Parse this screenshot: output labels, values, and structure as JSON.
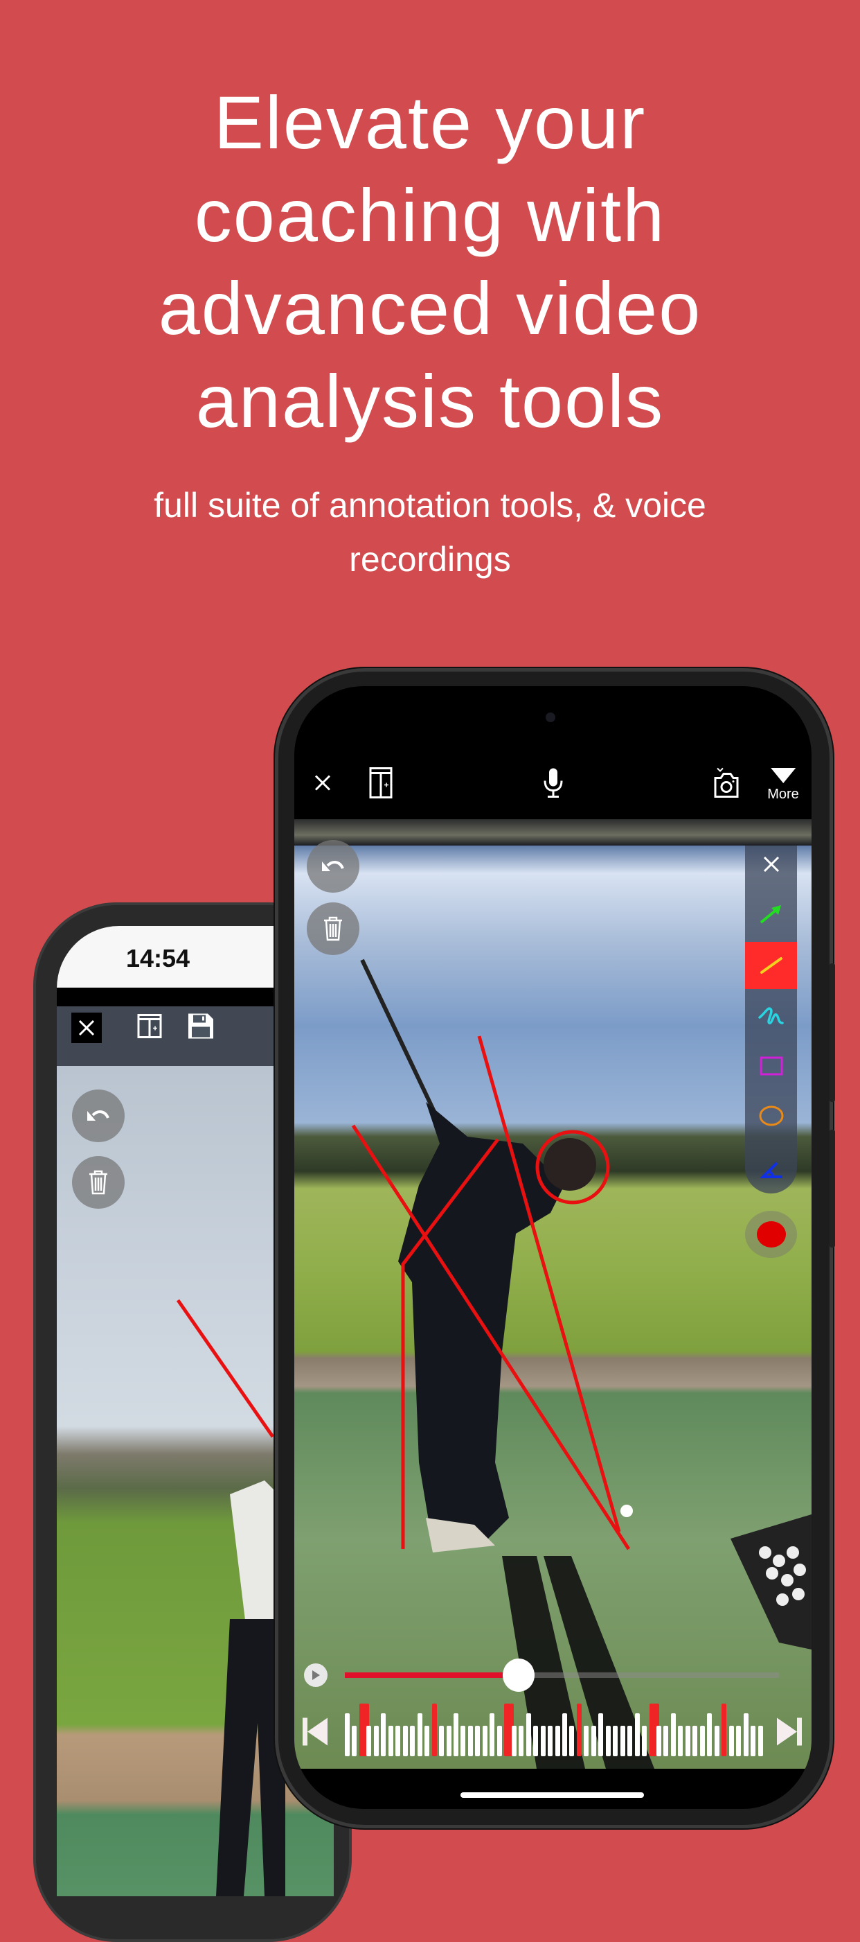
{
  "headline": {
    "lines": [
      "Elevate your",
      "coaching with",
      "advanced video",
      "analysis tools"
    ],
    "subtitle_lines": [
      "full suite of annotation tools, & voice",
      "recordings"
    ]
  },
  "colors": {
    "background": "#d14b4f",
    "annotation_red": "#e81010",
    "selected_tool": "#ff2a2a"
  },
  "back_phone": {
    "status_time": "14:54",
    "toolbar": {
      "icons": [
        "close-icon",
        "split-view-icon",
        "save-icon"
      ]
    },
    "overlay_buttons": [
      "undo-icon",
      "trash-icon"
    ]
  },
  "front_phone": {
    "toolbar": {
      "icons": [
        "close-icon",
        "split-view-icon",
        "microphone-icon",
        "camera-flip-icon",
        "more-icon"
      ],
      "more_label": "More"
    },
    "overlay_buttons": [
      "undo-icon",
      "trash-icon"
    ],
    "palette": {
      "tools": [
        {
          "name": "arrow",
          "color": "#22dd22"
        },
        {
          "name": "line",
          "color": "#f5d020",
          "selected": true
        },
        {
          "name": "freehand",
          "color": "#29d3e0"
        },
        {
          "name": "rectangle",
          "color": "#d020d8"
        },
        {
          "name": "circle",
          "color": "#e88a1a"
        },
        {
          "name": "angle",
          "color": "#1030e8"
        }
      ],
      "record_color": "#e00000"
    },
    "playback": {
      "progress": 0.4
    },
    "timeline": {
      "tick_count": 58,
      "marker_ticks": [
        2,
        12,
        22,
        32,
        42,
        52
      ]
    }
  }
}
